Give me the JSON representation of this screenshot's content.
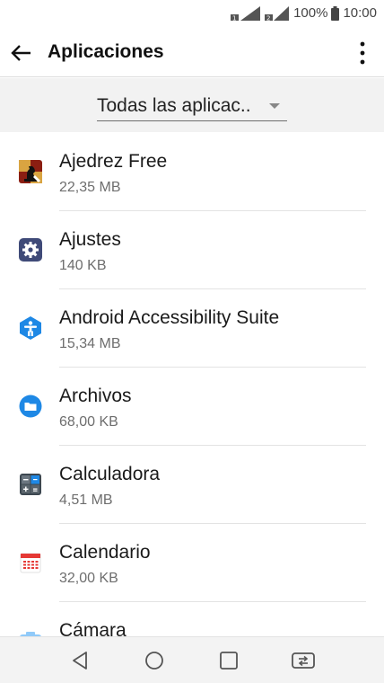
{
  "status_bar": {
    "battery": "100%",
    "time": "10:00"
  },
  "app_bar": {
    "title": "Aplicaciones",
    "back_icon": "arrow-left-icon",
    "more_icon": "more-vert-icon"
  },
  "filter": {
    "selected": "Todas las aplicac.."
  },
  "apps": [
    {
      "name": "Ajedrez Free",
      "size": "22,35 MB",
      "icon": "chess-app-icon"
    },
    {
      "name": "Ajustes",
      "size": "140 KB",
      "icon": "settings-app-icon"
    },
    {
      "name": "Android Accessibility Suite",
      "size": "15,34 MB",
      "icon": "accessibility-app-icon"
    },
    {
      "name": "Archivos",
      "size": "68,00 KB",
      "icon": "files-app-icon"
    },
    {
      "name": "Calculadora",
      "size": "4,51 MB",
      "icon": "calculator-app-icon"
    },
    {
      "name": "Calendario",
      "size": "32,00 KB",
      "icon": "calendar-app-icon"
    },
    {
      "name": "Cámara",
      "size": "",
      "icon": "camera-app-icon"
    }
  ],
  "nav_bar": {
    "back_icon": "nav-back-icon",
    "home_icon": "nav-home-icon",
    "recents_icon": "nav-recents-icon",
    "dual_window_icon": "nav-dual-window-icon"
  },
  "colors": {
    "accessibility_blue": "#1e88e5",
    "settings_indigo": "#3f4a78",
    "files_blue": "#1e88e5",
    "calendar_red": "#e53935"
  }
}
